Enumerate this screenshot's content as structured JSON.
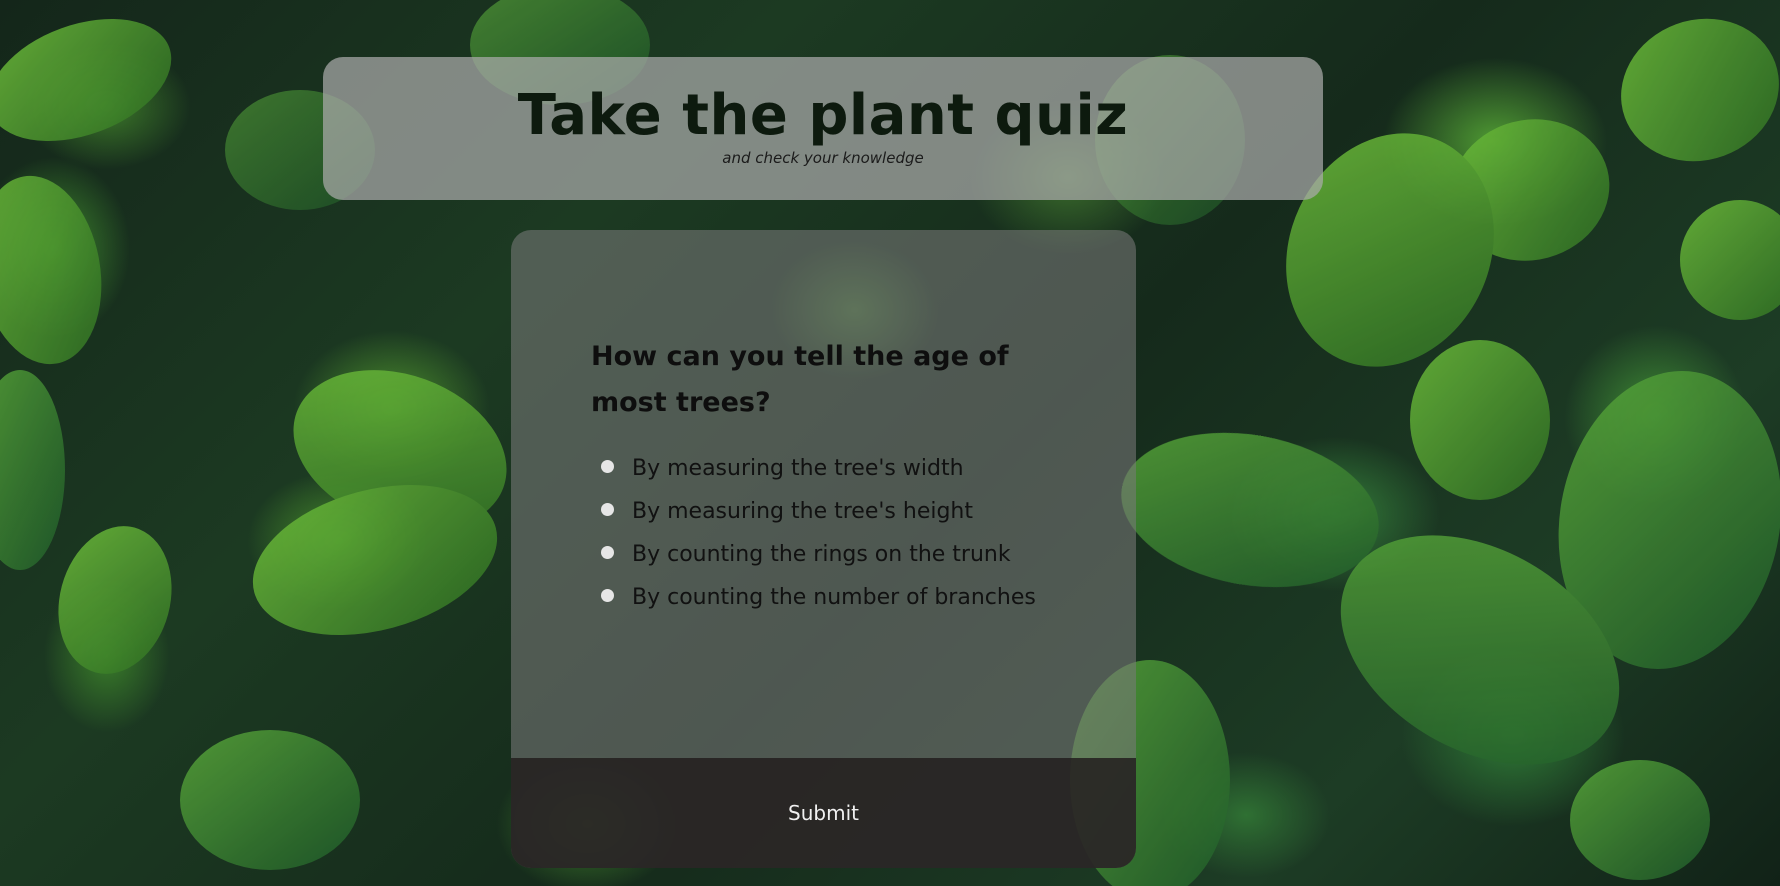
{
  "header": {
    "title": "Take the plant quiz",
    "subtitle": "and check your knowledge"
  },
  "quiz": {
    "question": "How can you tell the age of most trees?",
    "answers": [
      "By measuring the tree's width",
      "By measuring the tree's height",
      "By counting the rings on the trunk",
      "By counting the number of branches"
    ],
    "submit_label": "Submit"
  },
  "colors": {
    "leaf_green": "#4f9a33",
    "background_dark": "#14261a",
    "header_panel": "#aaaaaa",
    "quiz_panel": "#787878",
    "submit_bar": "#231e1e",
    "radio_fill": "#e6e6e6"
  },
  "background": {
    "image": "green-leaves-photo"
  }
}
